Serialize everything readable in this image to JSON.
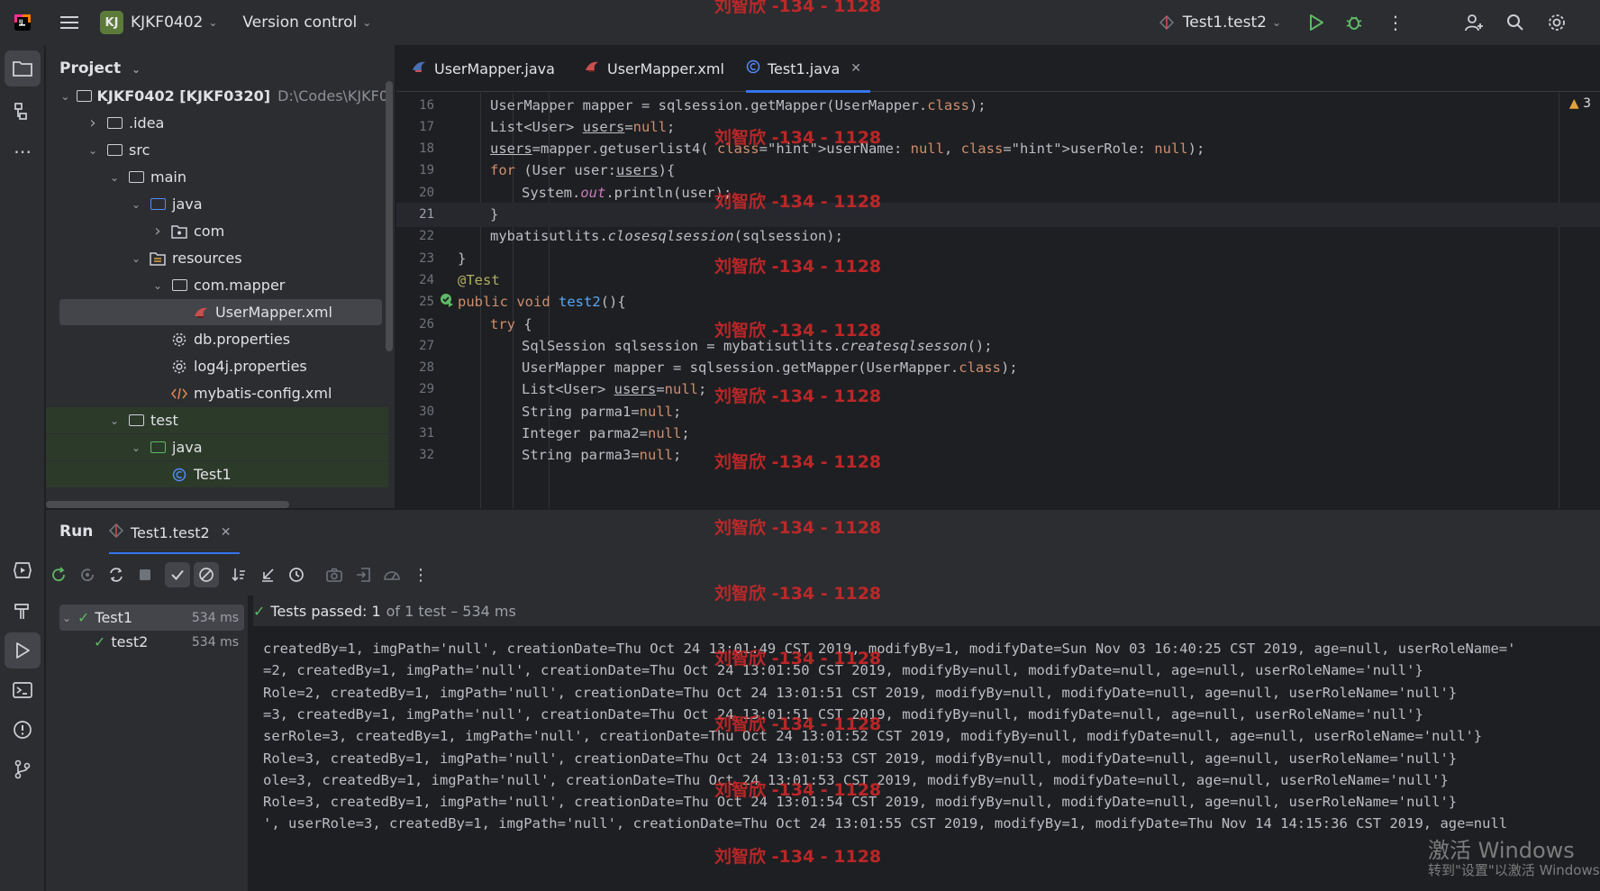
{
  "titlebar": {
    "project_badge": "KJ",
    "project_name": "KJKF0402",
    "vcs_label": "Version control",
    "run_config": "Test1.test2"
  },
  "project_panel": {
    "title": "Project",
    "tree": [
      {
        "label": "KJKF0402 [KJKF0320]",
        "hint": "D:\\Codes\\KJKF0",
        "depth": 0,
        "expanded": true,
        "kind": "module"
      },
      {
        "label": ".idea",
        "depth": 1,
        "expanded": false,
        "kind": "folder"
      },
      {
        "label": "src",
        "depth": 1,
        "expanded": true,
        "kind": "folder"
      },
      {
        "label": "main",
        "depth": 2,
        "expanded": true,
        "kind": "folder"
      },
      {
        "label": "java",
        "depth": 3,
        "expanded": true,
        "kind": "source-folder"
      },
      {
        "label": "com",
        "depth": 4,
        "expanded": false,
        "kind": "package"
      },
      {
        "label": "resources",
        "depth": 3,
        "expanded": true,
        "kind": "resources-folder"
      },
      {
        "label": "com.mapper",
        "depth": 4,
        "expanded": true,
        "kind": "folder"
      },
      {
        "label": "UserMapper.xml",
        "depth": 5,
        "kind": "mybatis-file",
        "selected": true
      },
      {
        "label": "db.properties",
        "depth": 4,
        "kind": "properties-file"
      },
      {
        "label": "log4j.properties",
        "depth": 4,
        "kind": "properties-file"
      },
      {
        "label": "mybatis-config.xml",
        "depth": 4,
        "kind": "xml-file"
      },
      {
        "label": "test",
        "depth": 2,
        "expanded": true,
        "kind": "folder"
      },
      {
        "label": "java",
        "depth": 3,
        "expanded": true,
        "kind": "test-folder"
      },
      {
        "label": "Test1",
        "depth": 4,
        "kind": "class-file"
      }
    ]
  },
  "editor": {
    "tabs": [
      {
        "label": "UserMapper.java",
        "active": false
      },
      {
        "label": "UserMapper.xml",
        "active": false
      },
      {
        "label": "Test1.java",
        "active": true
      }
    ],
    "warning_count": "3",
    "lines": [
      {
        "n": "16",
        "text": "UserMapper mapper = sqlsession.getMapper(UserMapper.class);"
      },
      {
        "n": "17",
        "text": "List<User> users=null;"
      },
      {
        "n": "18",
        "text": "users=mapper.getuserlist4( userName: null, userRole: null);"
      },
      {
        "n": "19",
        "text": "for (User user:users){"
      },
      {
        "n": "20",
        "text": "System.out.println(user);"
      },
      {
        "n": "21",
        "text": "}"
      },
      {
        "n": "22",
        "text": "mybatisutlits.closesqlsession(sqlsession);"
      },
      {
        "n": "23",
        "text": "}"
      },
      {
        "n": "24",
        "text": "@Test"
      },
      {
        "n": "25",
        "text": "public void test2(){"
      },
      {
        "n": "26",
        "text": "try {"
      },
      {
        "n": "27",
        "text": "SqlSession sqlsession = mybatisutlits.createsqlsesson();"
      },
      {
        "n": "28",
        "text": "UserMapper mapper = sqlsession.getMapper(UserMapper.class);"
      },
      {
        "n": "29",
        "text": "List<User> users=null;"
      },
      {
        "n": "30",
        "text": "String parma1=null;"
      },
      {
        "n": "31",
        "text": "Integer parma2=null;"
      },
      {
        "n": "32",
        "text": "String parma3=null;"
      }
    ]
  },
  "run": {
    "title": "Run",
    "tab_label": "Test1.test2",
    "tests": [
      {
        "label": "Test1",
        "time": "534 ms"
      },
      {
        "label": "test2",
        "time": "534 ms"
      }
    ],
    "status": "Tests passed: 1",
    "status_detail": "of 1 test – 534 ms",
    "output": [
      "createdBy=1, imgPath='null', creationDate=Thu Oct 24 13:01:49 CST 2019, modifyBy=1, modifyDate=Sun Nov 03 16:40:25 CST 2019, age=null, userRoleName='",
      "=2, createdBy=1, imgPath='null', creationDate=Thu Oct 24 13:01:50 CST 2019, modifyBy=null, modifyDate=null, age=null, userRoleName='null'}",
      "Role=2, createdBy=1, imgPath='null', creationDate=Thu Oct 24 13:01:51 CST 2019, modifyBy=null, modifyDate=null, age=null, userRoleName='null'}",
      "=3, createdBy=1, imgPath='null', creationDate=Thu Oct 24 13:01:51 CST 2019, modifyBy=null, modifyDate=null, age=null, userRoleName='null'}",
      "serRole=3, createdBy=1, imgPath='null', creationDate=Thu Oct 24 13:01:52 CST 2019, modifyBy=null, modifyDate=null, age=null, userRoleName='null'}",
      "Role=3, createdBy=1, imgPath='null', creationDate=Thu Oct 24 13:01:53 CST 2019, modifyBy=null, modifyDate=null, age=null, userRoleName='null'}",
      "ole=3, createdBy=1, imgPath='null', creationDate=Thu Oct 24 13:01:53 CST 2019, modifyBy=null, modifyDate=null, age=null, userRoleName='null'}",
      "Role=3, createdBy=1, imgPath='null', creationDate=Thu Oct 24 13:01:54 CST 2019, modifyBy=null, modifyDate=null, age=null, userRoleName='null'}",
      "', userRole=3, createdBy=1, imgPath='null', creationDate=Thu Oct 24 13:01:55 CST 2019, modifyBy=1, modifyDate=Thu Nov 14 14:15:36 CST 2019, age=null"
    ]
  },
  "watermark": {
    "text": "刘智欣 -134 - 1128",
    "windows_line1": "激活 Windows",
    "windows_line2": "转到\"设置\"以激活 Windows"
  },
  "colors": {
    "accent": "#3574f0",
    "pass_green": "#5fb865",
    "keyword": "#cf8e6d",
    "function": "#56a8f5",
    "watermark_red": "#d72828"
  }
}
